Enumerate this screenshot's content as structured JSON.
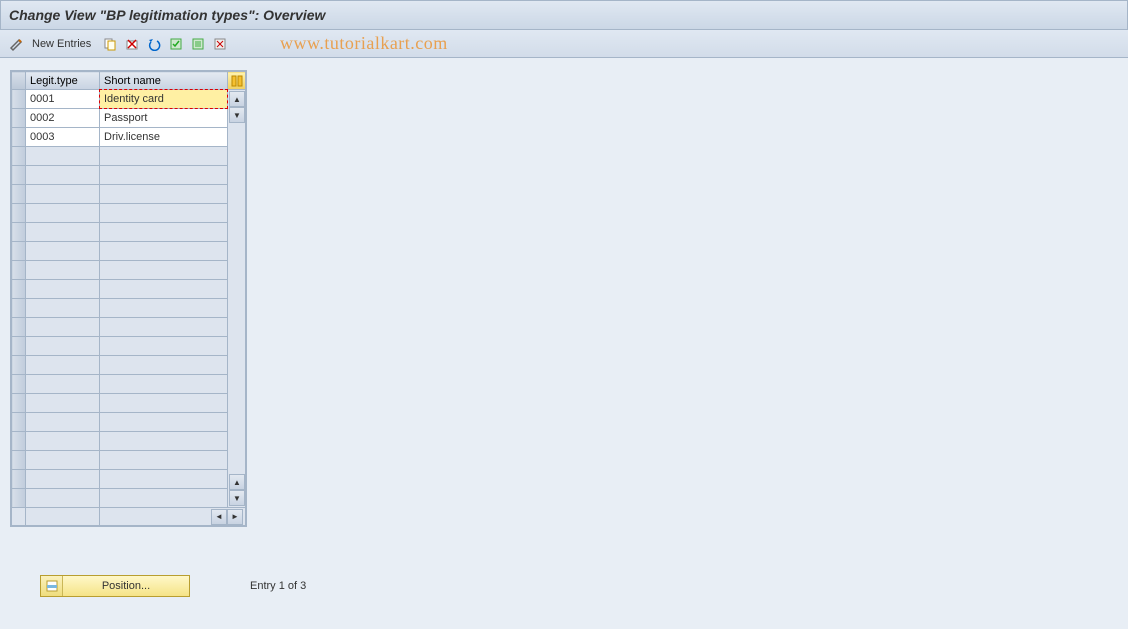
{
  "title": "Change View \"BP legitimation types\": Overview",
  "toolbar": {
    "new_entries_label": "New Entries"
  },
  "watermark": "www.tutorialkart.com",
  "table": {
    "headers": {
      "col1": "Legit.type",
      "col2": "Short name"
    },
    "rows": [
      {
        "code": "0001",
        "name": "Identity card",
        "selected": true
      },
      {
        "code": "0002",
        "name": "Passport",
        "selected": false
      },
      {
        "code": "0003",
        "name": "Driv.license",
        "selected": false
      }
    ],
    "empty_rows": 19
  },
  "footer": {
    "position_label": "Position...",
    "entry_status": "Entry 1 of 3"
  }
}
